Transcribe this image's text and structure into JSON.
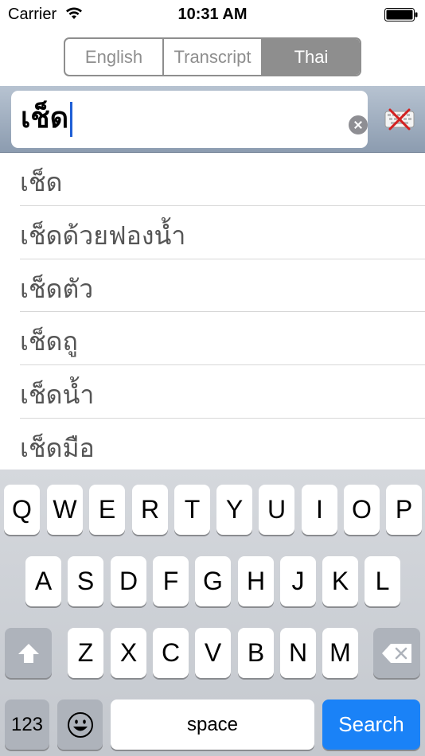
{
  "status_bar": {
    "carrier": "Carrier",
    "time": "10:31 AM"
  },
  "segmented_control": {
    "segments": [
      "English",
      "Transcript",
      "Thai"
    ],
    "selected": "Thai"
  },
  "search": {
    "value": "เช็ด"
  },
  "results": [
    "เช็ด",
    "เช็ดด้วยฟองน้ำ",
    "เช็ดตัว",
    "เช็ดถู",
    "เช็ดน้ำ",
    "เช็ดมือ"
  ],
  "keyboard": {
    "row1": [
      "Q",
      "W",
      "E",
      "R",
      "T",
      "Y",
      "U",
      "I",
      "O",
      "P"
    ],
    "row2": [
      "A",
      "S",
      "D",
      "F",
      "G",
      "H",
      "J",
      "K",
      "L"
    ],
    "row3": [
      "Z",
      "X",
      "C",
      "V",
      "B",
      "N",
      "M"
    ],
    "numbers_label": "123",
    "space_label": "space",
    "search_label": "Search"
  },
  "colors": {
    "accent": "#1a82f7",
    "segment_active": "#8e8e8e"
  }
}
